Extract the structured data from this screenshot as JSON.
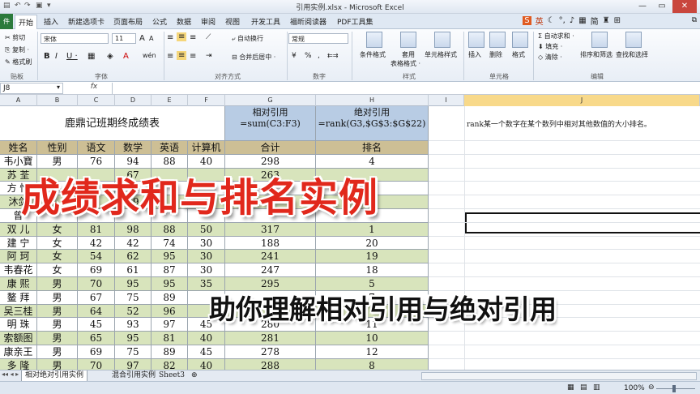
{
  "window": {
    "title": "引用实例.xlsx - Microsoft Excel"
  },
  "ime": {
    "labels": [
      "英",
      "简"
    ]
  },
  "ribbon": {
    "file_tab": "件",
    "tabs": [
      "开始",
      "插入",
      "新建选项卡",
      "页面布局",
      "公式",
      "数据",
      "审阅",
      "视图",
      "开发工具",
      "福昕阅读器",
      "PDF工具集"
    ],
    "clipboard": {
      "cut": "剪切",
      "copy": "复制 ·",
      "format_painter": "格式刷",
      "label": "贴板"
    },
    "font": {
      "name": "宋体",
      "size": "11",
      "bold": "B",
      "italic": "I",
      "underline": "U ·",
      "grow": "A",
      "shrink": "A",
      "color_letter": "A",
      "wen": "wén",
      "label": "字体"
    },
    "alignment": {
      "wrap": "自动换行",
      "merge": "合并后居中 ·",
      "label": "对齐方式"
    },
    "number": {
      "format": "常规",
      "percent": "%",
      "comma": ",",
      "label": "数字"
    },
    "styles": {
      "cond": "条件格式",
      "table": "套用",
      "table2": "表格格式 ·",
      "cell": "单元格样式",
      "label": "样式"
    },
    "cells": {
      "insert": "插入",
      "delete": "删除",
      "format": "格式",
      "label": "单元格"
    },
    "editing": {
      "autosum": "自动求和 ·",
      "fill": "填充 ·",
      "clear": "清除 ·",
      "sort": "排序和筛选",
      "find": "查找和选择",
      "label": "编辑"
    }
  },
  "formula_bar": {
    "name_box": "J8",
    "fx": "fx"
  },
  "columns": [
    "A",
    "B",
    "C",
    "D",
    "E",
    "F",
    "G",
    "H",
    "I",
    "J"
  ],
  "sheet": {
    "title": "鹿鼎记班期终成绩表",
    "g_header": [
      "相对引用",
      "=sum(C3:F3)"
    ],
    "h_header": [
      "绝对引用",
      "=rank(G3,$G$3:$G$22)"
    ],
    "note": "rank某一个数字在某个数列中相对其他数值的大小排名。",
    "headers": [
      "姓名",
      "性别",
      "语文",
      "数学",
      "英语",
      "计算机",
      "合计",
      "排名"
    ],
    "rows": [
      [
        "韦小寶",
        "男",
        "76",
        "94",
        "88",
        "40",
        "298",
        "4"
      ],
      [
        "苏 荃",
        "",
        "",
        "67",
        "",
        "",
        "263",
        ""
      ],
      [
        "方 怡",
        "",
        "",
        "",
        "",
        "",
        "",
        ""
      ],
      [
        "沐剑",
        "",
        "",
        "79",
        "",
        "",
        "",
        ""
      ],
      [
        "曾",
        "",
        "",
        "",
        "",
        "",
        "",
        ""
      ],
      [
        "双 儿",
        "女",
        "81",
        "98",
        "88",
        "50",
        "317",
        "1"
      ],
      [
        "建 宁",
        "女",
        "42",
        "42",
        "74",
        "30",
        "188",
        "20"
      ],
      [
        "阿 珂",
        "女",
        "54",
        "62",
        "95",
        "30",
        "241",
        "19"
      ],
      [
        "韦春花",
        "女",
        "69",
        "61",
        "87",
        "30",
        "247",
        "18"
      ],
      [
        "康 熙",
        "男",
        "70",
        "95",
        "95",
        "35",
        "295",
        "5"
      ],
      [
        "鳌 拜",
        "男",
        "67",
        "75",
        "89",
        "",
        "",
        "7"
      ],
      [
        "吴三桂",
        "男",
        "64",
        "52",
        "96",
        "",
        "",
        ""
      ],
      [
        "明 珠",
        "男",
        "45",
        "93",
        "97",
        "45",
        "280",
        "11"
      ],
      [
        "索额图",
        "男",
        "65",
        "95",
        "81",
        "40",
        "281",
        "10"
      ],
      [
        "康亲王",
        "男",
        "69",
        "75",
        "89",
        "45",
        "278",
        "12"
      ],
      [
        "多 隆",
        "男",
        "70",
        "97",
        "82",
        "40",
        "288",
        "8"
      ]
    ]
  },
  "sheet_tabs": [
    "相对绝对引用实例",
    "混合引用实例",
    "Sheet3"
  ],
  "status": {
    "zoom": "100%"
  },
  "overlay": {
    "title": "成绩求和与排名实例",
    "subtitle": "助你理解相对引用与绝对引用"
  }
}
